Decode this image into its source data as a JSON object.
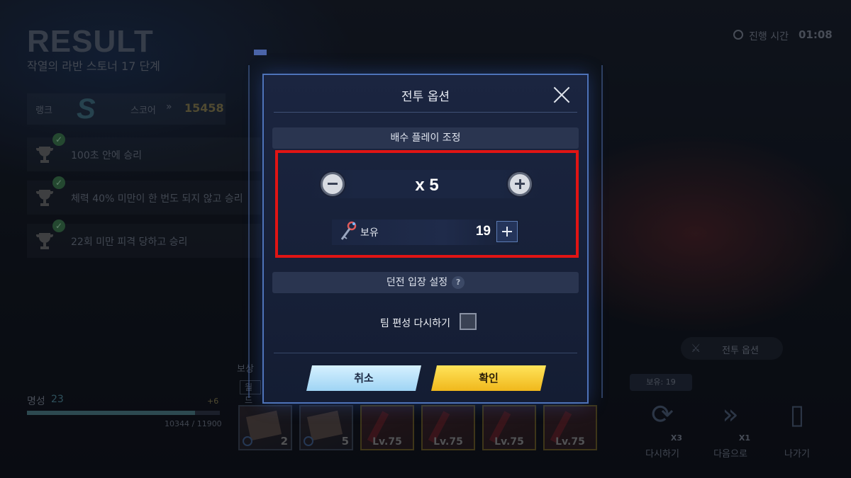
{
  "background": {
    "title": "RESULT",
    "stage": "작열의 라반 스토너 17 단계",
    "timer": {
      "label": "진행 시간",
      "value": "01:08"
    },
    "rank": {
      "label": "랭크",
      "letter": "S",
      "score_label": "스코어",
      "score_arrow": "»",
      "score": "15458"
    },
    "missions": [
      {
        "text": "100초 안에 승리"
      },
      {
        "text": "체력 40% 미만이 한 번도 되지 않고 승리"
      },
      {
        "text": "22회 미만 피격 당하고 승리"
      }
    ],
    "fame": {
      "label": "명성",
      "level": "23",
      "gain": "+6",
      "exp": "10344 / 11900",
      "progress": 0.87
    },
    "reward": {
      "label": "보상",
      "tag": "월드"
    },
    "items": [
      {
        "kind": "letter",
        "qty": "2"
      },
      {
        "kind": "letter",
        "qty": "5"
      },
      {
        "kind": "gear",
        "level": "Lv.75"
      },
      {
        "kind": "gear",
        "level": "Lv.75"
      },
      {
        "kind": "gear",
        "level": "Lv.75"
      },
      {
        "kind": "gear",
        "level": "Lv.75"
      }
    ],
    "battle_option_button": "전투 옵션",
    "hold_badge": "보유: 19",
    "actions": [
      {
        "label": "다시하기",
        "mult": "X3",
        "icon": "sword-replay-icon"
      },
      {
        "label": "다음으로",
        "mult": "X1",
        "icon": "double-chevron-icon"
      },
      {
        "label": "나가기",
        "mult": "",
        "icon": "door-exit-icon"
      }
    ]
  },
  "modal": {
    "title": "전투 옵션",
    "multiplier_section": "배수 플레이 조정",
    "multiplier": "x 5",
    "hold_label": "보유",
    "hold_count": "19",
    "dungeon_section": "던전 입장 설정",
    "help": "?",
    "reform_label": "팀 편성 다시하기",
    "cancel": "취소",
    "confirm": "확인"
  },
  "colors": {
    "highlight": "#e01414",
    "confirm": "#f5c62a",
    "cancel": "#b8e2fa",
    "modal_border": "#4e73b8"
  }
}
